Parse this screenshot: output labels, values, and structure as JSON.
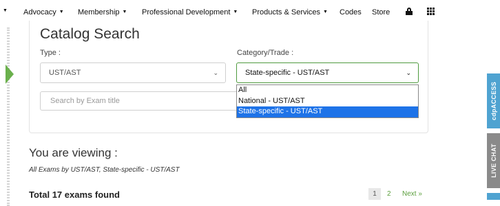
{
  "nav": {
    "items": [
      {
        "label": "Advocacy",
        "caret": "▼"
      },
      {
        "label": "Membership",
        "caret": "▼"
      },
      {
        "label": "Professional Development",
        "caret": "▼"
      },
      {
        "label": "Products & Services",
        "caret": "▼"
      },
      {
        "label": "Codes",
        "caret": ""
      },
      {
        "label": "Store",
        "caret": ""
      }
    ],
    "leading_caret": "▼"
  },
  "catalog": {
    "title": "Catalog Search",
    "type_label": "Type :",
    "type_value": "UST/AST",
    "category_label": "Category/Trade :",
    "category_value": "State-specific - UST/AST",
    "search_placeholder": "Search by Exam title",
    "dropdown_options": [
      {
        "label": "All",
        "selected": false
      },
      {
        "label": "National - UST/AST",
        "selected": false
      },
      {
        "label": "State-specific - UST/AST",
        "selected": true
      }
    ]
  },
  "results": {
    "heading": "You are viewing :",
    "subheading": "All Exams by UST/AST, State-specific - UST/AST",
    "total": "Total 17 exams found",
    "pagination": {
      "current": "1",
      "page2": "2",
      "next": "Next »"
    }
  },
  "side_tabs": {
    "access": "cdpACCESS",
    "chat": "LIVE CHAT"
  },
  "colors": {
    "accent_green": "#4e9a3e",
    "link_green": "#5a9e3c",
    "selection_blue": "#1e73e8",
    "tab_blue": "#4fa3d1",
    "tab_gray": "#8a8a8a"
  }
}
